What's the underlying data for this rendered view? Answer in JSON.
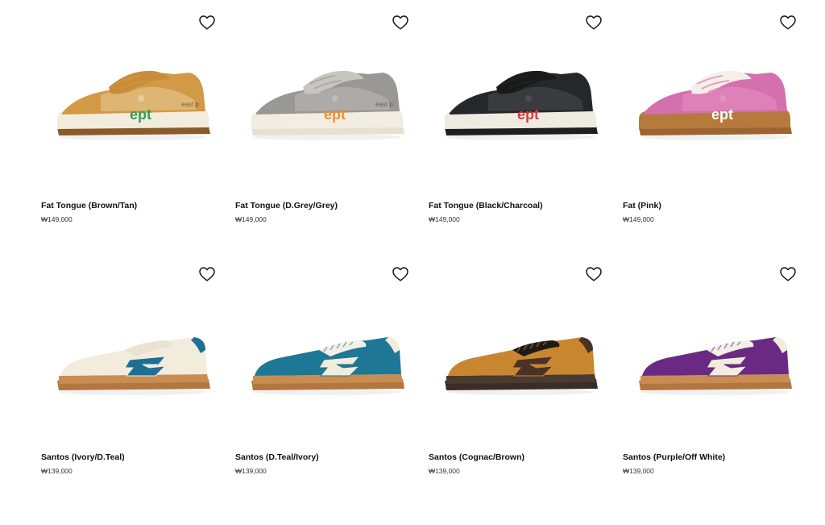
{
  "products": [
    {
      "name": "Fat Tongue (Brown/Tan)",
      "price": "₩149,000",
      "style": "fat",
      "upper": "#d29a45",
      "accent": "#e8cd9a",
      "sole": "#f2ecdc",
      "outsole": "#8a5a2b",
      "lace": "#c98d3a",
      "logo": "ept",
      "logo_color": "#2f9e5a",
      "side_text": "east p"
    },
    {
      "name": "Fat Tongue (D.Grey/Grey)",
      "price": "₩149,000",
      "style": "fat",
      "upper": "#9a9894",
      "accent": "#bdbbb6",
      "sole": "#f1ede2",
      "outsole": "#e6e0cf",
      "lace": "#c9c6c0",
      "logo": "ept",
      "logo_color": "#f0922a",
      "side_text": "east p"
    },
    {
      "name": "Fat Tongue (Black/Charcoal)",
      "price": "₩149,000",
      "style": "fat",
      "upper": "#25272b",
      "accent": "#4a4c50",
      "sole": "#efebe0",
      "outsole": "#1f1f1f",
      "lace": "#1a1a1a",
      "logo": "ept",
      "logo_color": "#d63a3a",
      "side_text": ""
    },
    {
      "name": "Fat (Pink)",
      "price": "₩149,000",
      "style": "fat",
      "upper": "#d470ad",
      "accent": "#e690c2",
      "sole": "#b57a3c",
      "outsole": "#9c6430",
      "lace": "#f4efe8",
      "logo": "ept",
      "logo_color": "#ffffff",
      "side_text": ""
    },
    {
      "name": "Santos (Ivory/D.Teal)",
      "price": "₩139,000",
      "style": "santos",
      "upper": "#f2ecdc",
      "accent": "#1f6f95",
      "sole": "#c98d52",
      "outsole": "#b27640",
      "lace": "#e9e2d2",
      "logo": "",
      "logo_color": "#1f6f95",
      "side_text": ""
    },
    {
      "name": "Santos (D.Teal/Ivory)",
      "price": "₩139,000",
      "style": "santos",
      "upper": "#1d7795",
      "accent": "#f2ecdc",
      "sole": "#c98d52",
      "outsole": "#b27640",
      "lace": "#f4efe6",
      "logo": "",
      "logo_color": "#f2ecdc",
      "side_text": ""
    },
    {
      "name": "Santos (Cognac/Brown)",
      "price": "₩139,000",
      "style": "santos",
      "upper": "#c98630",
      "accent": "#4a3326",
      "sole": "#4a3a30",
      "outsole": "#3a2d25",
      "lace": "#1f1a17",
      "logo": "",
      "logo_color": "#4a3326",
      "side_text": ""
    },
    {
      "name": "Santos (Purple/Off White)",
      "price": "₩139,000",
      "style": "santos",
      "upper": "#6a2a83",
      "accent": "#f2ecdc",
      "sole": "#c98d52",
      "outsole": "#b27640",
      "lace": "#f4efe6",
      "logo": "",
      "logo_color": "#f2ecdc",
      "side_text": ""
    }
  ]
}
